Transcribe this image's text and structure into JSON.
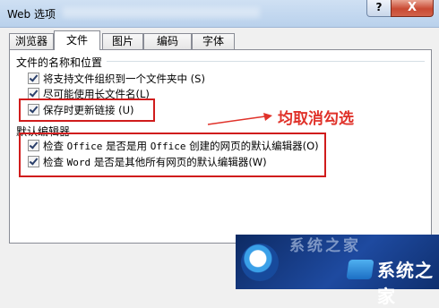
{
  "window": {
    "title": "Web 选项",
    "help_label": "?",
    "close_label": "X"
  },
  "tabs": [
    {
      "label": "浏览器",
      "active": false
    },
    {
      "label": "文件",
      "active": true
    },
    {
      "label": "图片",
      "active": false
    },
    {
      "label": "编码",
      "active": false
    },
    {
      "label": "字体",
      "active": false
    }
  ],
  "section_names": {
    "title": "文件的名称和位置",
    "items": [
      {
        "label": "将支持文件组织到一个文件夹中",
        "shortcut": "(S)",
        "checked": true
      },
      {
        "label": "尽可能使用长文件名",
        "shortcut": "(L)",
        "checked": true
      },
      {
        "label": "保存时更新链接",
        "shortcut": "(U)",
        "checked": true
      }
    ]
  },
  "section_editor": {
    "title": "默认编辑器",
    "items": [
      {
        "prefix": "检查",
        "app": "Office",
        "middle": "是否是用",
        "app2": "Office",
        "suffix": "创建的网页的默认编辑器",
        "shortcut": "(O)",
        "checked": true
      },
      {
        "prefix": "检查",
        "app": "Word",
        "middle": "是否是其他所有网页的默认编辑器",
        "shortcut": "(W)",
        "checked": true
      }
    ]
  },
  "annotation": {
    "text": "均取消勾选",
    "color": "#e0322a"
  },
  "watermark": {
    "ghost_text": "系统之家",
    "text": "系统之家"
  },
  "colors": {
    "highlight_box": "#d01c1c",
    "titlebar": "#b9d1ec",
    "close_button": "#c94a33"
  }
}
